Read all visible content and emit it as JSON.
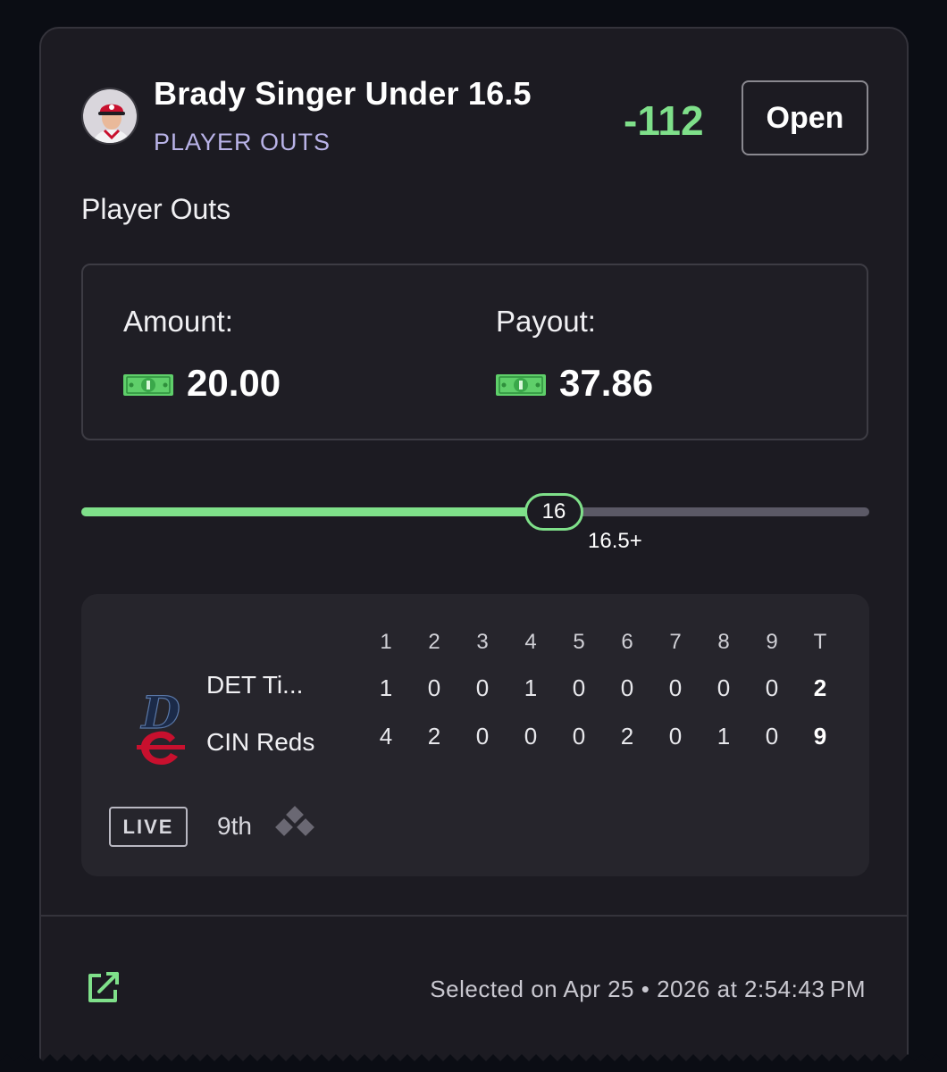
{
  "bet": {
    "title": "Brady Singer Under 16.5",
    "subtitle": "PLAYER OUTS",
    "odds": "-112",
    "status_button": "Open",
    "market": "Player Outs"
  },
  "amounts": {
    "amount_label": "Amount:",
    "amount_value": "20.00",
    "payout_label": "Payout:",
    "payout_value": "37.86",
    "currency_icon": "cash-icon"
  },
  "progress": {
    "current": "16",
    "line_label": "16.5+",
    "fraction": 0.6,
    "accent_color": "#7fe08a"
  },
  "scoreboard": {
    "innings": [
      "1",
      "2",
      "3",
      "4",
      "5",
      "6",
      "7",
      "8",
      "9",
      "T"
    ],
    "teams": [
      {
        "name": "DET Ti...",
        "logo": "tigers-d-logo",
        "scores": [
          "1",
          "0",
          "0",
          "1",
          "0",
          "0",
          "0",
          "0",
          "0",
          "2"
        ]
      },
      {
        "name": "CIN Reds",
        "logo": "reds-c-logo",
        "scores": [
          "4",
          "2",
          "0",
          "0",
          "0",
          "2",
          "0",
          "1",
          "0",
          "9"
        ]
      }
    ],
    "live_badge": "LIVE",
    "inning": "9th"
  },
  "footer": {
    "selected_text": "Selected on Apr 25 • 2026 at 2:54:43 PM",
    "share_icon": "external-link-icon"
  }
}
